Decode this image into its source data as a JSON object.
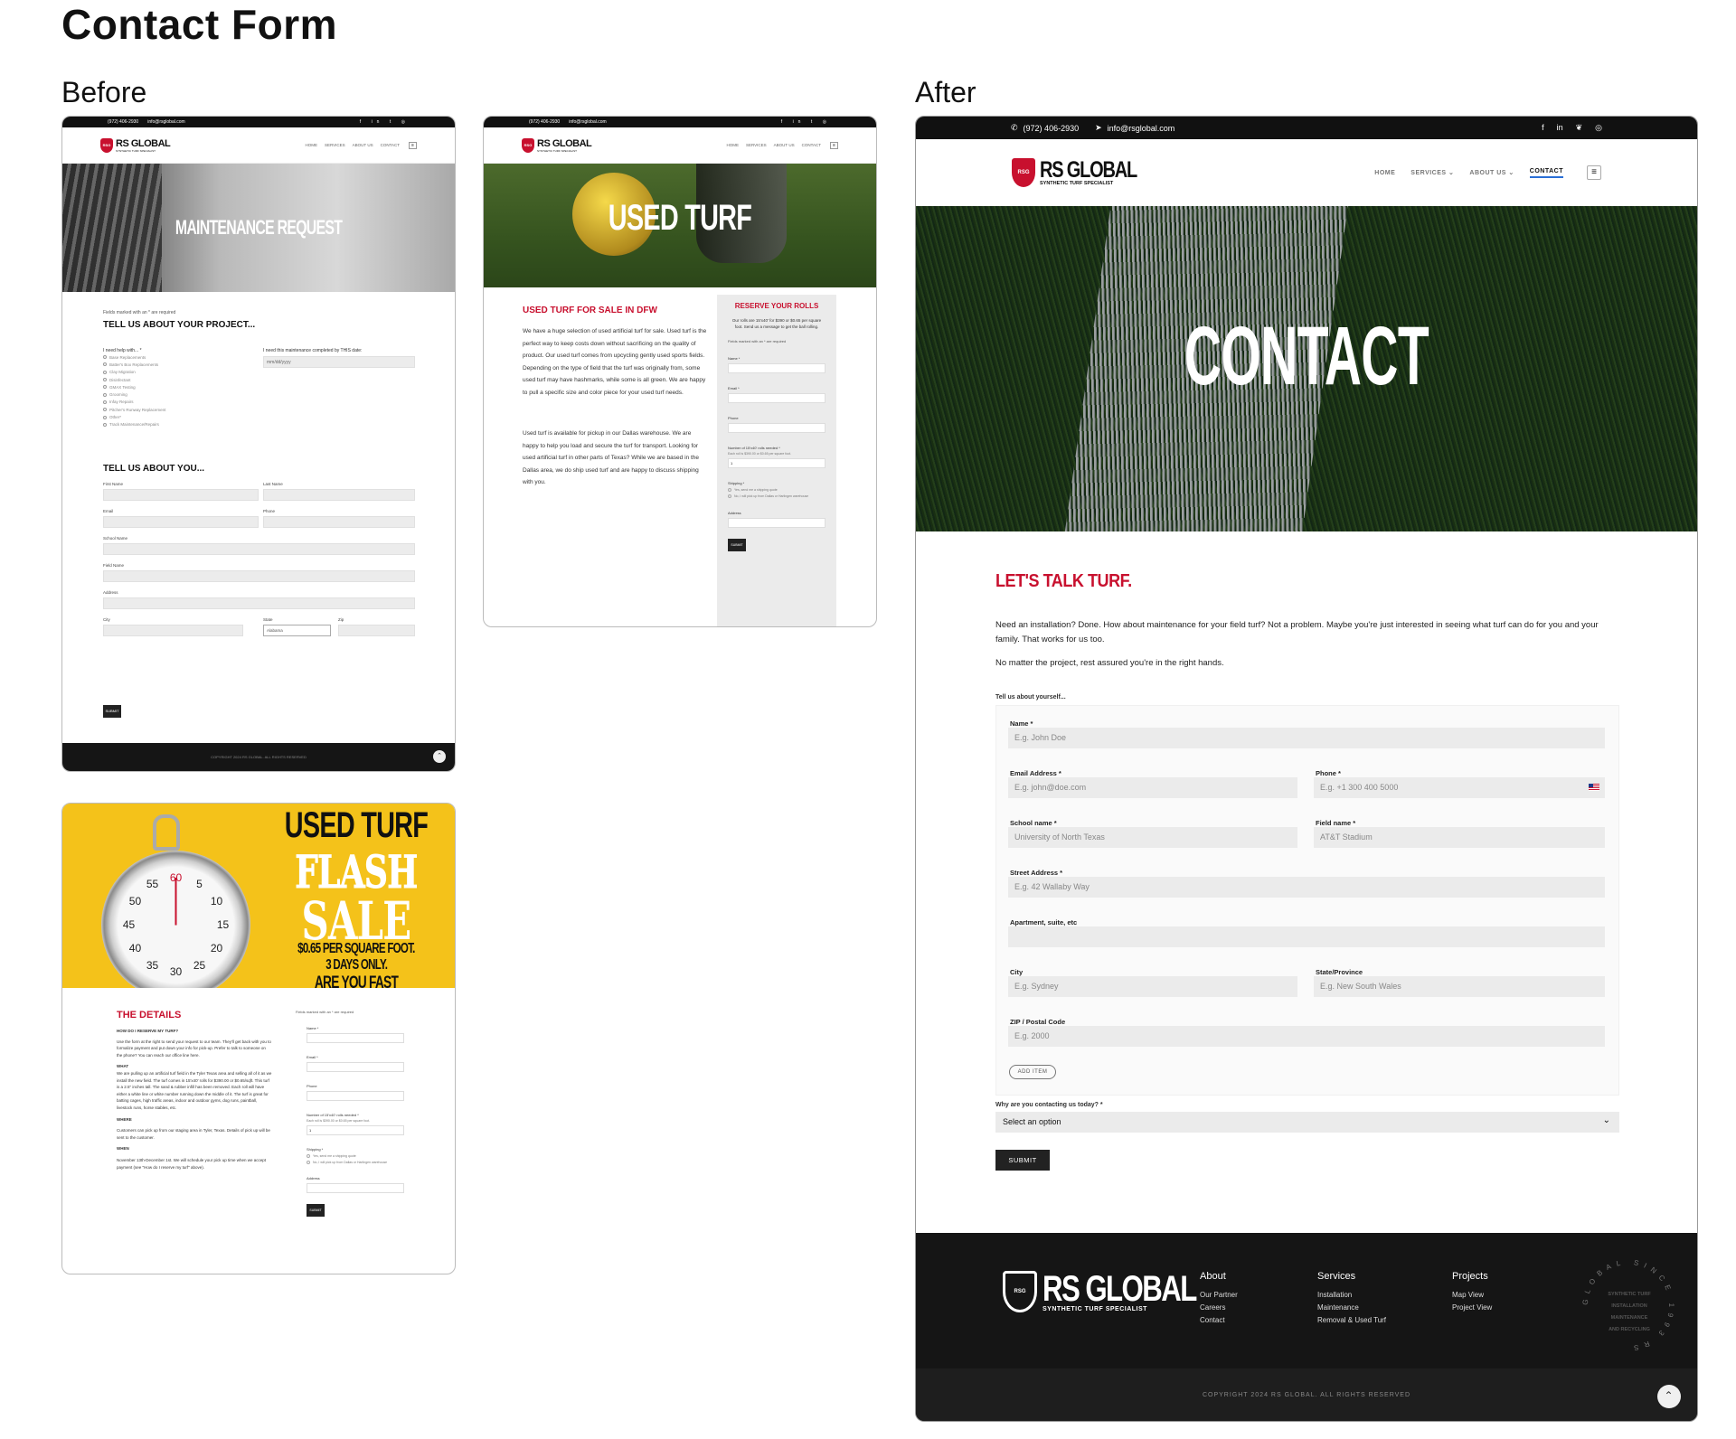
{
  "page": {
    "title": "Contact Form",
    "before_label": "Before",
    "after_label": "After"
  },
  "brand": {
    "name": "RS GLOBAL",
    "tagline": "SYNTHETIC TURF SPECIALIST",
    "badge": "RSG",
    "year": "1993"
  },
  "topbar": {
    "phone": "(972) 406-2930",
    "email": "info@rsglobal.com",
    "icons": [
      "facebook-icon",
      "linkedin-icon",
      "twitter-icon",
      "instagram-icon"
    ]
  },
  "nav": {
    "items": [
      "HOME",
      "SERVICES",
      "ABOUT US",
      "CONTACT"
    ]
  },
  "colors": {
    "accent": "#c8102e",
    "dark": "#111111",
    "field": "#ebebeb"
  },
  "maintenance": {
    "hero": "MAINTENANCE REQUEST",
    "note": "Fields marked with an * are required",
    "section1": "TELL US ABOUT YOUR PROJECT...",
    "need_help_label": "I need help with... *",
    "options": [
      "Base Replacements",
      "Batter's Box Replacements",
      "Clay Migration",
      "Disinfectant",
      "GMAX Testing",
      "Grooming",
      "Infay Repairs",
      "Pitcher's Runway Replacement",
      "Other*",
      "Track Maintenance/Repairs"
    ],
    "date_label": "I need this maintenance completed by THIS date:",
    "date_placeholder": "mm/dd/yyyy",
    "section2": "TELL US ABOUT YOU...",
    "labels": {
      "first": "First Name",
      "last": "Last Name",
      "email": "Email",
      "phone": "Phone",
      "school": "School Name",
      "field": "Field Name",
      "address": "Address",
      "city": "City",
      "state": "State",
      "zip": "Zip"
    },
    "state_value": "Alabama",
    "submit": "SUBMIT",
    "copyright": "COPYRIGHT 2024 RS GLOBAL. ALL RIGHTS RESERVED"
  },
  "used_turf": {
    "hero": "USED TURF",
    "heading": "USED TURF FOR SALE IN DFW",
    "p1": "We have a huge selection of used artificial turf for sale. Used turf is the perfect way to keep costs down without sacrificing on the quality of product. Our used turf comes from upcycling gently used sports fields. Depending on the type of field that the turf was originally from, some used turf may have hashmarks, while some is all green. We are happy to pull a specific size and color piece for your used turf needs.",
    "p2": "Used turf is available for pickup in our Dallas warehouse. We are happy to help you load and secure the turf for transport. Looking for used artificial turf in other parts of Texas? While we are based in the Dallas area, we do ship used turf and are happy to discuss shipping with you.",
    "side_heading": "RESERVE YOUR ROLLS",
    "side_intro": "Our rolls are 15'x40' for $390 or $0.65 per square foot. Send us a message to get the ball rolling.",
    "note": "Fields marked with an * are required",
    "labels": {
      "name": "Name *",
      "email": "Email *",
      "phone": "Phone",
      "rolls": "Number of 15'x40' rolls needed *",
      "shipping": "Shipping *",
      "address": "Address"
    },
    "rolls_hint": "Each roll is $390.00 or $0.65 per square foot.",
    "rolls_value": "1",
    "shipping_options": [
      "Yes, send me a shipping quote",
      "No, I will pick up from Dallas or Harlingen warehouse"
    ],
    "submit": "SUBMIT"
  },
  "flash": {
    "line1": "USED TURF",
    "line2": "FLASH",
    "line3": "SALE",
    "line4": "$0.65 PER SQUARE FOOT.",
    "line5": "3 DAYS ONLY.",
    "line6": "ARE YOU FAST ENOUGH?",
    "dial": [
      "60",
      "5",
      "10",
      "15",
      "20",
      "25",
      "30",
      "35",
      "40",
      "45",
      "50",
      "55"
    ],
    "details_heading": "THE DETAILS",
    "q1": "HOW DO I RESERVE MY TURF?",
    "a1": "Use the form at the right to send your request to our team. They'll get back with you to formalize payment and put down your info for pick-up. Prefer to talk to someone on the phone? You can reach our office line here.",
    "q2": "WHAT",
    "a2": "We are pulling up an artificial turf field in the Tyler Texas area and selling all of it as we install the new field. The turf comes in 15'x40' rolls for $390.00 or $0.65/sqft. This turf is a 2.5\" inches tall. The sand & rubber infill has been removed. Each roll will have either a white line or white number running down the middle of it. The turf is great for batting cages, high traffic areas, indoor and outdoor gyms, dog runs, paintball, livestock runs, horse stables, etc.",
    "q3": "WHERE",
    "a3": "Customers can pick up from our staging area in Tyler, Texas. Details of pick up will be sent to the customer.",
    "q4": "WHEN",
    "a4": "November 13th-December 1st. We will schedule your pick up time when we accept payment (see \"How do I reserve my turf\" above).",
    "note": "Fields marked with an * are required",
    "labels": {
      "name": "Name *",
      "email": "Email *",
      "phone": "Phone",
      "rolls": "Number of 15'x40' rolls needed *",
      "shipping": "Shipping *",
      "address": "Address"
    },
    "rolls_hint": "Each roll is $390.00 or $0.65 per square foot.",
    "rolls_value": "1",
    "shipping_options": [
      "Yes, send me a shipping quote",
      "No, I will pick up from Dallas or Harlingen warehouse"
    ],
    "submit": "SUBMIT"
  },
  "contact": {
    "hero": "CONTACT",
    "heading": "LET'S TALK TURF.",
    "p1": "Need an installation? Done. How about maintenance for your field turf? Not a problem. Maybe you're just interested in seeing what turf can do for you and your family. That works for us too.",
    "p2": "No matter the project, rest assured you're in the right hands.",
    "intro_label": "Tell us about yourself...",
    "fields": {
      "name": {
        "label": "Name *",
        "placeholder": "E.g. John Doe"
      },
      "email": {
        "label": "Email Address *",
        "placeholder": "E.g. john@doe.com"
      },
      "phone": {
        "label": "Phone *",
        "placeholder": "E.g. +1 300 400 5000"
      },
      "school": {
        "label": "School name *",
        "placeholder": "University of North Texas"
      },
      "fieldname": {
        "label": "Field name *",
        "placeholder": "AT&T Stadium"
      },
      "street": {
        "label": "Street Address *",
        "placeholder": "E.g. 42 Wallaby Way"
      },
      "apt": {
        "label": "Apartment, suite, etc",
        "placeholder": ""
      },
      "city": {
        "label": "City",
        "placeholder": "E.g. Sydney"
      },
      "state": {
        "label": "State/Province",
        "placeholder": "E.g. New South Wales"
      },
      "zip": {
        "label": "ZIP / Postal Code",
        "placeholder": "E.g. 2000"
      }
    },
    "add_item": "ADD ITEM",
    "reason_label": "Why are you contacting us today? *",
    "reason_value": "Select an option",
    "submit": "SUBMIT"
  },
  "footer": {
    "cols": [
      {
        "title": "About",
        "links": [
          "Our Partner",
          "Careers",
          "Contact"
        ]
      },
      {
        "title": "Services",
        "links": [
          "Installation",
          "Maintenance",
          "Removal & Used Turf"
        ]
      },
      {
        "title": "Projects",
        "links": [
          "Map View",
          "Project View"
        ]
      }
    ],
    "seal_ring": "GLOBAL SINCE 1993 RS",
    "seal_lines": [
      "SYNTHETIC TURF",
      "INSTALLATION",
      "MAINTENANCE",
      "AND RECYCLING"
    ],
    "copyright": "COPYRIGHT 2024 RS GLOBAL. ALL RIGHTS RESERVED"
  }
}
